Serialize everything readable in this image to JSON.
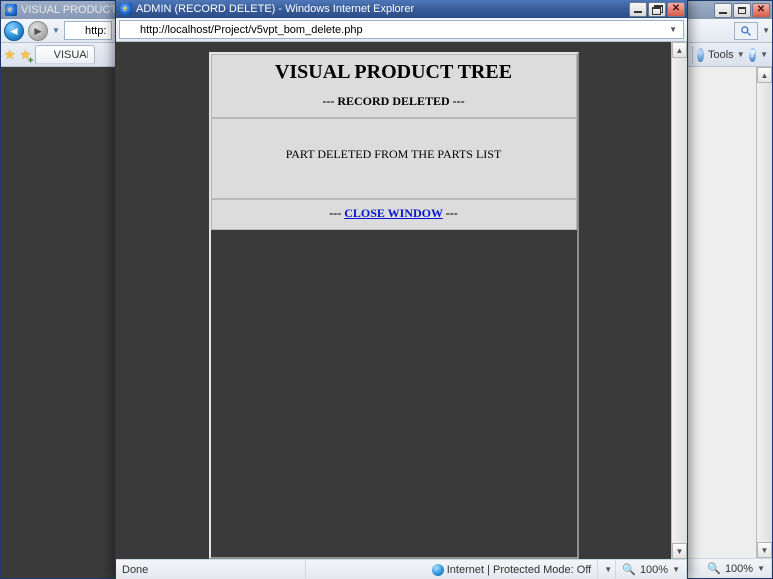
{
  "bg_window": {
    "title": "VISUAL PRODUCT TREE",
    "address": "http://loc",
    "tab_label": "VISUAL PR"
  },
  "fg_window": {
    "title": "ADMIN (RECORD DELETE) - Windows Internet Explorer",
    "address": "http://localhost/Project/v5vpt_bom_delete.php"
  },
  "right_window": {
    "tools_label": "Tools"
  },
  "page": {
    "heading": "VISUAL PRODUCT TREE",
    "subheading": "--- RECORD DELETED ---",
    "body": "PART DELETED FROM THE PARTS LIST",
    "footer_prefix": "--- ",
    "footer_link": "CLOSE WINDOW",
    "footer_suffix": " ---"
  },
  "status": {
    "left": "Done",
    "zone": "Internet | Protected Mode: Off",
    "zoom_fg": "100%",
    "zoom_right": "100%"
  }
}
